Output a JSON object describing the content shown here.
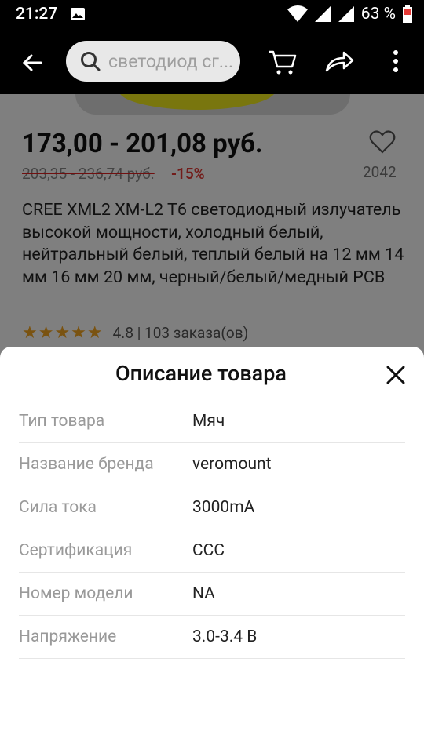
{
  "status": {
    "time": "21:27",
    "battery": "63 %",
    "icons": [
      "image-icon",
      "wifi-icon",
      "signal-icon",
      "battery-icon"
    ]
  },
  "topbar": {
    "search_text": "светодиод сг...",
    "icons": [
      "back-arrow-icon",
      "search-icon",
      "cart-icon",
      "share-icon",
      "more-icon"
    ]
  },
  "product": {
    "price": "173,00 - 201,08 руб.",
    "old_price": "203,35 - 236,74 руб.",
    "discount": "-15%",
    "wishlist_count": "2042",
    "title": "CREE XML2 XM-L2 T6 светодиодный излучатель высокой мощности, холодный белый, нейтральный белый, теплый белый на 12 мм 14 мм 16 мм 20 мм, черный/белый/медный PCB",
    "stars": "★★★★★",
    "rating_text": "4.8 | 103 заказа(ов)"
  },
  "sheet": {
    "title": "Описание товара",
    "specs": [
      {
        "key": "Тип товара",
        "value": "Мяч"
      },
      {
        "key": "Название бренда",
        "value": "veromount"
      },
      {
        "key": "Сила тока",
        "value": "3000mA"
      },
      {
        "key": "Сертификация",
        "value": "CCC"
      },
      {
        "key": "Номер модели",
        "value": "NA"
      },
      {
        "key": "Напряжение",
        "value": "3.0-3.4 В"
      }
    ]
  },
  "colors": {
    "accent_red": "#e53935",
    "star": "#f5a623",
    "topbar": "#000000"
  }
}
